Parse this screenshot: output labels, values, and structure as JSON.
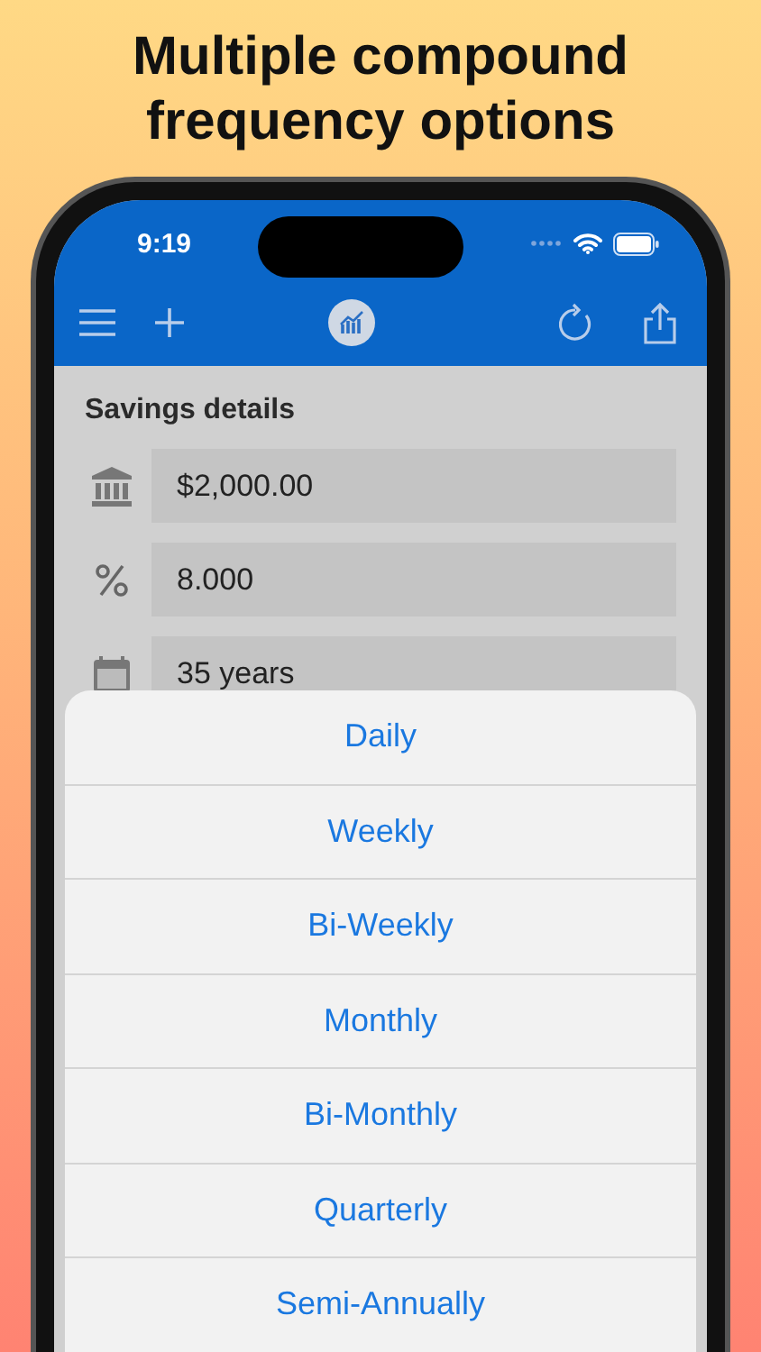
{
  "headline": [
    "Multiple compound",
    "frequency options"
  ],
  "status_bar": {
    "time": "9:19"
  },
  "section_title": "Savings details",
  "fields": [
    {
      "kind": "bank",
      "value": "$2,000.00"
    },
    {
      "kind": "percent",
      "value": "8.000"
    },
    {
      "kind": "calendar",
      "value": "35 years"
    }
  ],
  "options": [
    "Daily",
    "Weekly",
    "Bi-Weekly",
    "Monthly",
    "Bi-Monthly",
    "Quarterly",
    "Semi-Annually"
  ]
}
